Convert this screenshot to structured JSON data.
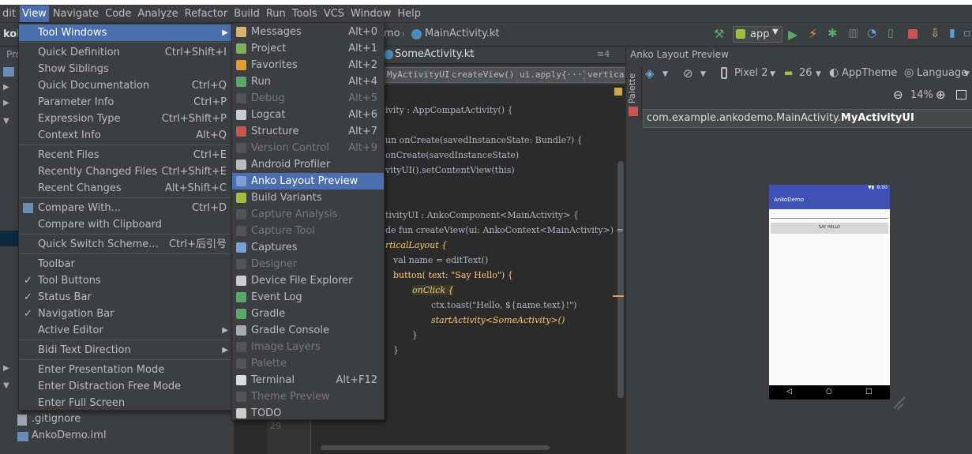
{
  "menubar": [
    "dit",
    "View",
    "Navigate",
    "Code",
    "Analyze",
    "Refactor",
    "Build",
    "Run",
    "Tools",
    "VCS",
    "Window",
    "Help"
  ],
  "active_menu": "View",
  "toolbar": {
    "breadcrumb_1": "mo",
    "breadcrumb_2": "MainActivity.kt",
    "run_config": "app"
  },
  "view_menu": [
    {
      "label": "Tool Windows",
      "shortcut": "",
      "submenu": true,
      "selected": true
    },
    {
      "sep": true
    },
    {
      "label": "Quick Definition",
      "shortcut": "Ctrl+Shift+I"
    },
    {
      "label": "Show Siblings",
      "shortcut": ""
    },
    {
      "label": "Quick Documentation",
      "shortcut": "Ctrl+Q"
    },
    {
      "label": "Parameter Info",
      "shortcut": "Ctrl+P"
    },
    {
      "label": "Expression Type",
      "shortcut": "Ctrl+Shift+P"
    },
    {
      "label": "Context Info",
      "shortcut": "Alt+Q"
    },
    {
      "sep": true
    },
    {
      "label": "Recent Files",
      "shortcut": "Ctrl+E"
    },
    {
      "label": "Recently Changed Files",
      "shortcut": "Ctrl+Shift+E"
    },
    {
      "label": "Recent Changes",
      "shortcut": "Alt+Shift+C"
    },
    {
      "sep": true
    },
    {
      "label": "Compare With...",
      "shortcut": "Ctrl+D",
      "icon": true
    },
    {
      "label": "Compare with Clipboard",
      "shortcut": ""
    },
    {
      "sep": true
    },
    {
      "label": "Quick Switch Scheme...",
      "shortcut": "Ctrl+后引号"
    },
    {
      "sep": true
    },
    {
      "label": "Toolbar",
      "shortcut": ""
    },
    {
      "label": "Tool Buttons",
      "shortcut": "",
      "checked": true
    },
    {
      "label": "Status Bar",
      "shortcut": "",
      "checked": true
    },
    {
      "label": "Navigation Bar",
      "shortcut": "",
      "checked": true
    },
    {
      "label": "Active Editor",
      "shortcut": "",
      "submenu": true
    },
    {
      "sep": true
    },
    {
      "label": "Bidi Text Direction",
      "shortcut": "",
      "submenu": true
    },
    {
      "sep": true
    },
    {
      "label": "Enter Presentation Mode",
      "shortcut": ""
    },
    {
      "label": "Enter Distraction Free Mode",
      "shortcut": ""
    },
    {
      "label": "Enter Full Screen",
      "shortcut": ""
    }
  ],
  "tool_windows": [
    {
      "label": "Messages",
      "shortcut": "Alt+0",
      "icon": "messages-icon",
      "color": "#d9b36c"
    },
    {
      "label": "Project",
      "shortcut": "Alt+1",
      "icon": "project-icon",
      "color": "#7fb05a"
    },
    {
      "label": "Favorites",
      "shortcut": "Alt+2",
      "icon": "star-icon",
      "color": "#e0a030"
    },
    {
      "label": "Run",
      "shortcut": "Alt+4",
      "icon": "run-icon",
      "color": "#59a869"
    },
    {
      "label": "Debug",
      "shortcut": "Alt+5",
      "icon": "debug-icon",
      "color": "#6a6a6a",
      "disabled": true
    },
    {
      "label": "Logcat",
      "shortcut": "Alt+6",
      "icon": "logcat-icon",
      "color": "#cccccc"
    },
    {
      "label": "Structure",
      "shortcut": "Alt+7",
      "icon": "structure-icon",
      "color": "#c75450"
    },
    {
      "label": "Version Control",
      "shortcut": "Alt+9",
      "icon": "vcs-icon",
      "color": "#6a6a6a",
      "disabled": true
    },
    {
      "label": "Android Profiler",
      "shortcut": "",
      "icon": "profiler-icon",
      "color": "#bbbbbb"
    },
    {
      "label": "Anko Layout Preview",
      "shortcut": "",
      "icon": "anko-icon",
      "color": "#7aa0d4",
      "selected": true
    },
    {
      "label": "Build Variants",
      "shortcut": "",
      "icon": "android-icon",
      "color": "#9fc03a"
    },
    {
      "label": "Capture Analysis",
      "shortcut": "",
      "icon": "capture-analysis-icon",
      "color": "#6a6a6a",
      "disabled": true
    },
    {
      "label": "Capture Tool",
      "shortcut": "",
      "icon": "capture-tool-icon",
      "color": "#6a6a6a",
      "disabled": true
    },
    {
      "label": "Captures",
      "shortcut": "",
      "icon": "captures-icon",
      "color": "#7aa0d4"
    },
    {
      "label": "Designer",
      "shortcut": "",
      "icon": "designer-icon",
      "color": "#6a6a6a",
      "disabled": true
    },
    {
      "label": "Device File Explorer",
      "shortcut": "",
      "icon": "device-icon",
      "color": "#cccccc"
    },
    {
      "label": "Event Log",
      "shortcut": "",
      "icon": "event-log-icon",
      "color": "#59a869"
    },
    {
      "label": "Gradle",
      "shortcut": "",
      "icon": "gradle-icon",
      "color": "#59a869"
    },
    {
      "label": "Gradle Console",
      "shortcut": "",
      "icon": "gradle-console-icon",
      "color": "#aaaaaa"
    },
    {
      "label": "Image Layers",
      "shortcut": "",
      "icon": "image-layers-icon",
      "color": "#6a6a6a",
      "disabled": true
    },
    {
      "label": "Palette",
      "shortcut": "",
      "icon": "palette-icon",
      "color": "#6a6a6a",
      "disabled": true
    },
    {
      "label": "Terminal",
      "shortcut": "Alt+F12",
      "icon": "terminal-icon",
      "color": "#dddddd"
    },
    {
      "label": "Theme Preview",
      "shortcut": "",
      "icon": "theme-icon",
      "color": "#6a6a6a",
      "disabled": true
    },
    {
      "label": "TODO",
      "shortcut": "",
      "icon": "todo-icon",
      "color": "#cccccc"
    }
  ],
  "left_tree": {
    "pro": "Pro",
    "gitignore": ".gitignore",
    "iml": "AnkoDemo.iml",
    "ako": "koD"
  },
  "editor": {
    "tab": "SomeActivity.kt",
    "tab_menu": "≡4",
    "crumbs": [
      "MyActivityUI",
      "createView()",
      "ui.apply{···}",
      "vertica"
    ],
    "line_no": "29",
    "lines": [
      "ivity : AppCompatActivity() {",
      "un onCreate(savedInstanceState: Bundle?) {",
      "onCreate(savedInstanceState)",
      "vityUI().setContentView(this)",
      "tivityUI : AnkoComponent<MainActivity> {",
      "de fun createView(ui: AnkoContext<MainActivity>) =",
      "rticalLayout {",
      "val name = editText()",
      "button( text: \"Say Hello\") {",
      "onClick {",
      "ctx.toast(\"Hello, ${name.text}!\")",
      "startActivity<SomeActivity>()",
      "}",
      "}"
    ]
  },
  "preview": {
    "title": "Anko Layout Preview",
    "palette": "Palette",
    "device": "Pixel 2",
    "api": "26",
    "theme": "AppTheme",
    "language": "Language",
    "zoom": "14%",
    "class_prefix": "com.example.ankodemo.MainActivity.",
    "class_name": "MyActivityUI",
    "app_name": "AnkoDemo",
    "status_time": "8:00",
    "button_text": "SAY HELLO",
    "nav": [
      "◁",
      "○",
      "□"
    ]
  }
}
